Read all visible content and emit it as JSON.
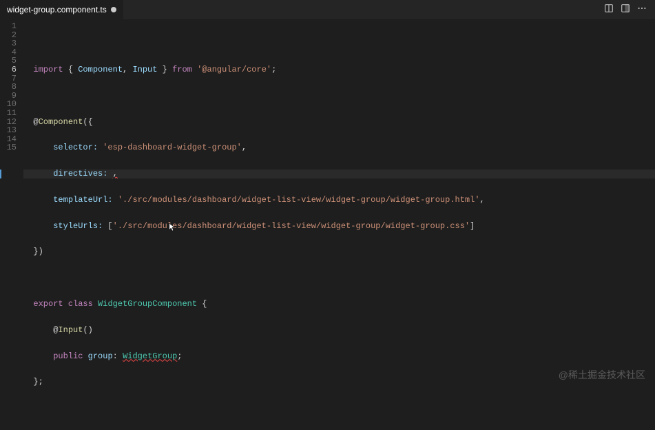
{
  "tab": {
    "filename": "widget-group.component.ts",
    "modified": true
  },
  "code": {
    "lineCount": 15,
    "lines": {
      "l1": "",
      "l2_import": "import",
      "l2_brace_open": " { ",
      "l2_component": "Component",
      "l2_comma": ", ",
      "l2_input": "Input",
      "l2_brace_close": " } ",
      "l2_from": "from",
      "l2_sp": " ",
      "l2_pkg": "'@angular/core'",
      "l2_semi": ";",
      "l3": "",
      "l4_at": "@",
      "l4_comp": "Component",
      "l4_open": "({",
      "l5_indent": "    ",
      "l5_key": "selector:",
      "l5_sp": " ",
      "l5_val": "'esp-dashboard-widget-group'",
      "l5_comma": ",",
      "l6_indent": "    ",
      "l6_key": "directives:",
      "l6_sp": " ",
      "l6_comma": ",",
      "l7_indent": "    ",
      "l7_key": "templateUrl:",
      "l7_sp": " ",
      "l7_val": "'./src/modules/dashboard/widget-list-view/widget-group/widget-group.html'",
      "l7_comma": ",",
      "l8_indent": "    ",
      "l8_key": "styleUrls:",
      "l8_sp": " [",
      "l8_val": "'./src/modules/dashboard/widget-list-view/widget-group/widget-group.css'",
      "l8_close": "]",
      "l9": "})",
      "l10": "",
      "l11_export": "export",
      "l11_sp1": " ",
      "l11_class": "class",
      "l11_sp2": " ",
      "l11_name": "WidgetGroupComponent",
      "l11_brace": " {",
      "l12_indent": "    @",
      "l12_input": "Input",
      "l12_paren": "()",
      "l13_indent": "    ",
      "l13_public": "public",
      "l13_sp": " ",
      "l13_group": "group",
      "l13_colon": ": ",
      "l13_type": "WidgetGroup",
      "l13_semi": ";",
      "l14": "};",
      "l15": ""
    }
  },
  "watermark": "@稀土掘金技术社区"
}
